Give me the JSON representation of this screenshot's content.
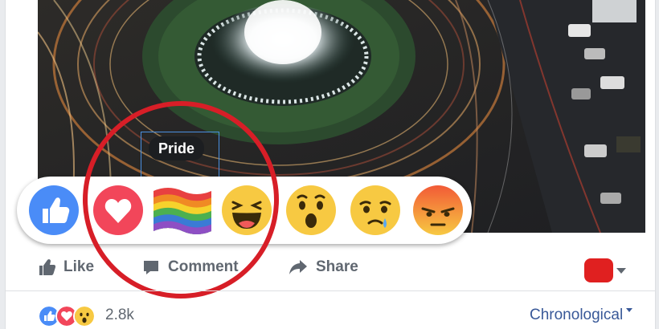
{
  "reactions": {
    "tooltip": "Pride",
    "items": [
      {
        "name": "like",
        "icon": "like-thumb-icon",
        "color": "#4a8cf7"
      },
      {
        "name": "love",
        "icon": "heart-icon",
        "color": "#f2465a"
      },
      {
        "name": "pride",
        "icon": "rainbow-flag-icon",
        "color": "#e84040"
      },
      {
        "name": "haha",
        "icon": "laughing-face-icon",
        "color": "#f7c942"
      },
      {
        "name": "wow",
        "icon": "surprised-face-icon",
        "color": "#f7c942"
      },
      {
        "name": "sad",
        "icon": "crying-face-icon",
        "color": "#f7c942"
      },
      {
        "name": "angry",
        "icon": "angry-face-icon",
        "color": "#f26b2b"
      }
    ]
  },
  "actions": {
    "like_label": "Like",
    "comment_label": "Comment",
    "share_label": "Share"
  },
  "summary": {
    "count": "2.8k",
    "sort_label": "Chronological"
  },
  "colors": {
    "highlight_circle": "#d71e27",
    "link_blue": "#385898",
    "muted_text": "#606770"
  }
}
